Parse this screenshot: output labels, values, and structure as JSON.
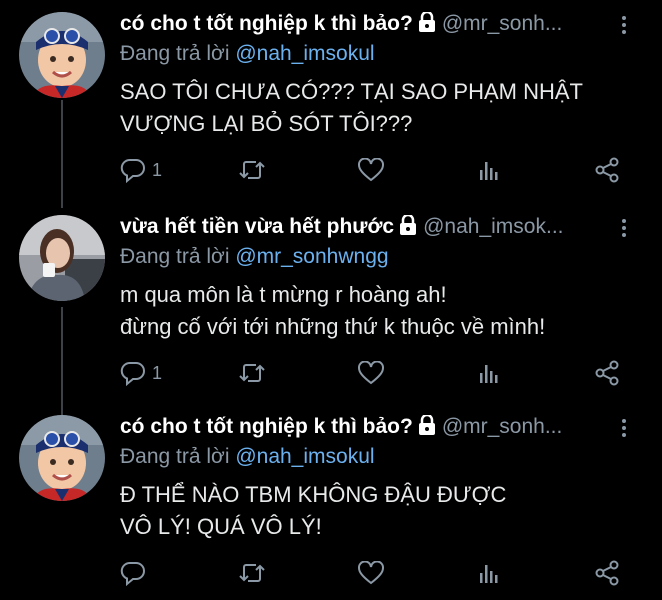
{
  "tweets": [
    {
      "name": "có cho t tốt nghiệp k thì bảo?",
      "handle": "@mr_sonh...",
      "reply_prefix": "Đang trả lời",
      "reply_to": "@nah_imsokul",
      "lines": [
        "SAO TÔI CHƯA CÓ??? TẠI SAO PHẠM NHẬT",
        "VƯỢNG LẠI BỎ SÓT TÔI???"
      ],
      "reply_count": "1",
      "avatar": "boy-with-goggles"
    },
    {
      "name": "vừa hết tiền vừa hết phước",
      "handle": "@nah_imsok...",
      "reply_prefix": "Đang trả lời",
      "reply_to": "@mr_sonhwngg",
      "lines": [
        "m qua môn là t mừng r hoàng ah!",
        "đừng cố với tới những thứ k thuộc về mình!"
      ],
      "reply_count": "1",
      "avatar": "woman-with-cup"
    },
    {
      "name": "có cho t tốt nghiệp k thì bảo?",
      "handle": "@mr_sonh...",
      "reply_prefix": "Đang trả lời",
      "reply_to": "@nah_imsokul",
      "lines": [
        "Đ THỂ NÀO TBM KHÔNG ĐẬU ĐƯỢC",
        "VÔ LÝ! QUÁ VÔ LÝ!"
      ],
      "reply_count": "",
      "avatar": "boy-with-goggles"
    }
  ],
  "icons": {
    "reply": "reply-icon",
    "retweet": "retweet-icon",
    "like": "like-icon",
    "views": "views-icon",
    "share": "share-icon",
    "lock": "lock-icon",
    "more": "more-icon"
  },
  "colors": {
    "background": "#000000",
    "text": "#e7e9ea",
    "muted": "#8b98a5",
    "mention": "#6cb1ef"
  }
}
